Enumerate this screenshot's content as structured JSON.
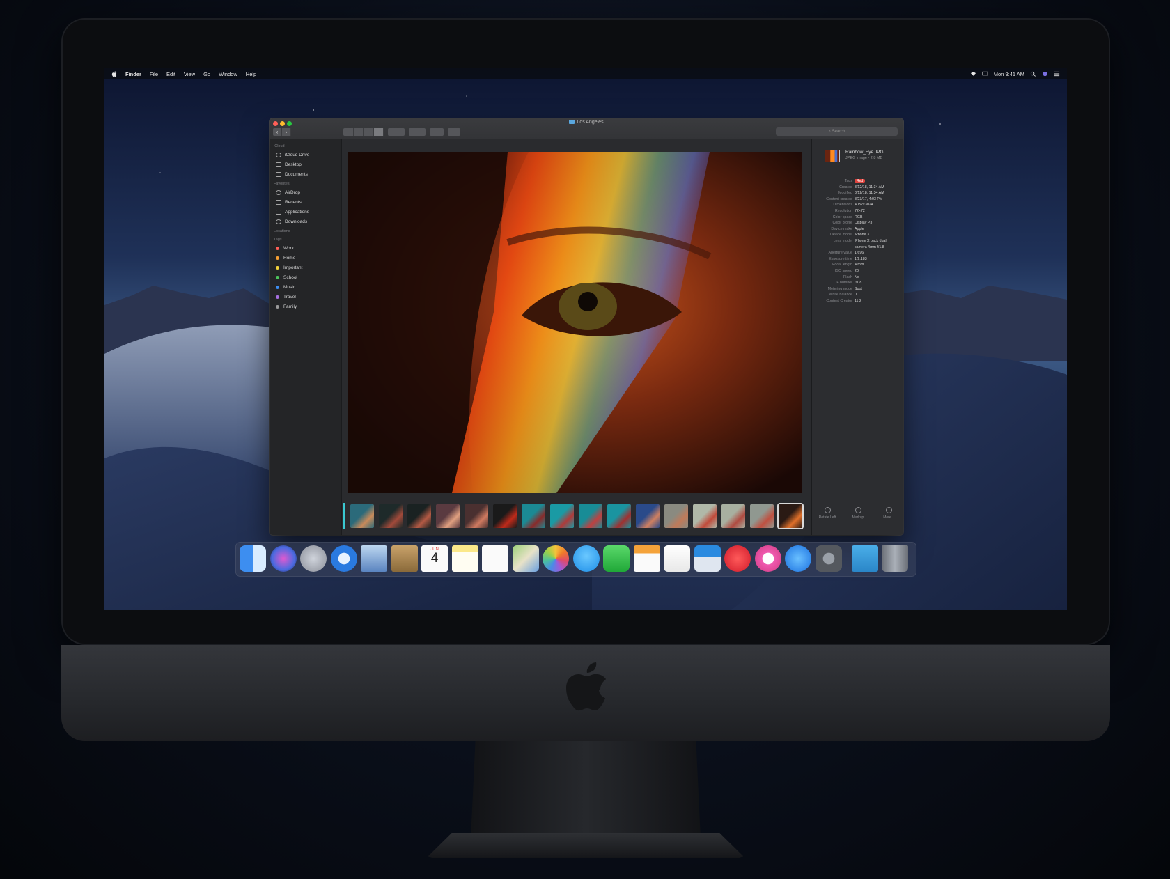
{
  "menubar": {
    "app_name": "Finder",
    "items": [
      "File",
      "Edit",
      "View",
      "Go",
      "Window",
      "Help"
    ],
    "clock": "Mon 9:41 AM"
  },
  "finder": {
    "title": "Los Angeles",
    "search_placeholder": "Search",
    "sidebar": {
      "sections": [
        {
          "header": "iCloud",
          "items": [
            "iCloud Drive",
            "Desktop",
            "Documents"
          ]
        },
        {
          "header": "Favorites",
          "items": [
            "AirDrop",
            "Recents",
            "Applications",
            "Downloads"
          ]
        },
        {
          "header": "Locations",
          "items": []
        },
        {
          "header": "Tags",
          "items": [
            "Work",
            "Home",
            "Important",
            "School",
            "Music",
            "Travel",
            "Family"
          ]
        }
      ],
      "tag_colors": [
        "#ff5f57",
        "#f6a033",
        "#f3d23b",
        "#4cc35c",
        "#3b8cf0",
        "#a66fe0",
        "#9a9a9a"
      ]
    },
    "inspector": {
      "filename": "Rainbow_Eye.JPG",
      "filetype": "JPEG image - 2.8 MB",
      "metadata": [
        {
          "label": "Tags",
          "value": "Red"
        },
        {
          "label": "Created",
          "value": "3/12/18, 11:34 AM"
        },
        {
          "label": "Modified",
          "value": "3/12/18, 11:34 AM"
        },
        {
          "label": "Content created",
          "value": "8/23/17, 4:03 PM"
        },
        {
          "label": "Dimensions",
          "value": "4032×3024"
        },
        {
          "label": "Resolution",
          "value": "72×72"
        },
        {
          "label": "Color space",
          "value": "RGB"
        },
        {
          "label": "Color profile",
          "value": "Display P3"
        },
        {
          "label": "Device make",
          "value": "Apple"
        },
        {
          "label": "Device model",
          "value": "iPhone X"
        },
        {
          "label": "Lens model",
          "value": "iPhone X back dual"
        },
        {
          "label": "",
          "value": "camera 4mm f/1.8"
        },
        {
          "label": "Aperture value",
          "value": "1.696"
        },
        {
          "label": "Exposure time",
          "value": "1/2,183"
        },
        {
          "label": "Focal length",
          "value": "4 mm"
        },
        {
          "label": "ISO speed",
          "value": "20"
        },
        {
          "label": "Flash",
          "value": "No"
        },
        {
          "label": "F number",
          "value": "f/1.8"
        },
        {
          "label": "Metering mode",
          "value": "Spot"
        },
        {
          "label": "White balance",
          "value": "0"
        },
        {
          "label": "Content Creator",
          "value": "11.2"
        }
      ],
      "actions": [
        "Rotate Left",
        "Markup",
        "More..."
      ]
    }
  },
  "dock": {
    "apps": [
      "finder-icon",
      "siri-icon",
      "launchpad-icon",
      "safari-icon",
      "mail-icon",
      "contacts-icon",
      "calendar-icon",
      "notes-icon",
      "reminders-icon",
      "maps-icon",
      "photos-icon",
      "messages-icon",
      "facetime-icon",
      "pages-icon",
      "numbers-icon",
      "keynote-icon",
      "news-icon",
      "itunes-icon",
      "app-store-icon",
      "system-preferences-icon",
      "downloads-folder-icon",
      "trash-icon"
    ],
    "calendar_day": "4",
    "calendar_month": "JUN"
  }
}
